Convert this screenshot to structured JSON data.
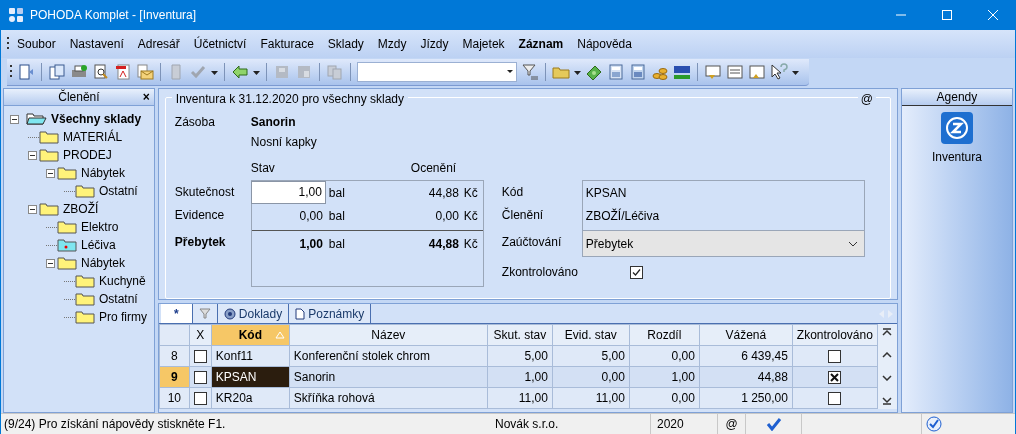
{
  "window": {
    "title": "POHODA Komplet - [Inventura]"
  },
  "menu": [
    {
      "label": "Soubor",
      "active": false
    },
    {
      "label": "Nastavení",
      "active": false
    },
    {
      "label": "Adresář",
      "active": false
    },
    {
      "label": "Účetnictví",
      "active": false
    },
    {
      "label": "Fakturace",
      "active": false
    },
    {
      "label": "Sklady",
      "active": false
    },
    {
      "label": "Mzdy",
      "active": false
    },
    {
      "label": "Jízdy",
      "active": false
    },
    {
      "label": "Majetek",
      "active": false
    },
    {
      "label": "Záznam",
      "active": true
    },
    {
      "label": "Nápověda",
      "active": false
    }
  ],
  "sidebar": {
    "title": "Členění",
    "close": "×",
    "tree": [
      {
        "label": "Všechny sklady",
        "kind": "root",
        "selected": true,
        "expanded": true,
        "children": [
          {
            "label": "MATERIÁL",
            "kind": "folder",
            "selected": false
          },
          {
            "label": "PRODEJ",
            "kind": "folder",
            "selected": false,
            "expanded": true,
            "children": [
              {
                "label": "Nábytek",
                "kind": "folder",
                "selected": false,
                "expanded": true,
                "children": [
                  {
                    "label": "Ostatní",
                    "kind": "folder",
                    "selected": false
                  }
                ]
              }
            ]
          },
          {
            "label": "ZBOŽÍ",
            "kind": "folder",
            "selected": false,
            "expanded": true,
            "children": [
              {
                "label": "Elektro",
                "kind": "folder",
                "selected": false
              },
              {
                "label": "Léčiva",
                "kind": "current",
                "selected": false
              },
              {
                "label": "Nábytek",
                "kind": "folder",
                "selected": false,
                "expanded": true,
                "children": [
                  {
                    "label": "Kuchyně",
                    "kind": "folder",
                    "selected": false
                  },
                  {
                    "label": "Ostatní",
                    "kind": "folder",
                    "selected": false
                  },
                  {
                    "label": "Pro firmy",
                    "kind": "folder",
                    "selected": false
                  }
                ]
              }
            ]
          }
        ]
      }
    ]
  },
  "form": {
    "title": "Inventura k 31.12.2020 pro všechny sklady",
    "at": "@",
    "stock_label": "Zásoba",
    "stock_name": "Sanorin",
    "stock_desc": "Nosní kapky",
    "col_state": "Stav",
    "col_value": "Ocenění",
    "rows": [
      {
        "kind": "input",
        "label": "Skutečnost",
        "qty": "1,00",
        "unit": "bal",
        "value": "44,88",
        "currency": "Kč"
      },
      {
        "kind": "plain",
        "label": "Evidence",
        "qty": "0,00",
        "unit": "bal",
        "value": "0,00",
        "currency": "Kč"
      },
      {
        "kind": "total",
        "label": "Přebytek",
        "qty": "1,00",
        "unit": "bal",
        "value": "44,88",
        "currency": "Kč"
      }
    ],
    "code_label": "Kód",
    "code": "KPSAN",
    "group_label": "Členění",
    "group": "ZBOŽÍ/Léčiva",
    "posting_label": "Zaúčtování",
    "posting": "Přebytek",
    "checked_label": "Zkontrolováno",
    "checked": true
  },
  "tabs": [
    {
      "kind": "star",
      "label": "*",
      "selected": true
    },
    {
      "kind": "filter",
      "selected": false
    },
    {
      "kind": "docs",
      "label": "Doklady",
      "selected": false
    },
    {
      "kind": "notes",
      "label": "Poznámky",
      "selected": false
    }
  ],
  "table": {
    "columns": [
      {
        "label": "X",
        "sorted": false
      },
      {
        "label": "Kód",
        "sorted": true
      },
      {
        "label": "Název",
        "sorted": false
      },
      {
        "label": "Skut. stav",
        "sorted": false
      },
      {
        "label": "Evid. stav",
        "sorted": false
      },
      {
        "label": "Rozdíl",
        "sorted": false
      },
      {
        "label": "Vážená",
        "sorted": false
      },
      {
        "label": "Zkontrolováno",
        "sorted": false
      }
    ],
    "rows": [
      {
        "number": "8",
        "marked": false,
        "cells": [
          "",
          "Konf11",
          "Konferenční stolek chrom",
          "5,00",
          "5,00",
          "0,00",
          "6 439,45"
        ],
        "checked": false,
        "selected": false
      },
      {
        "number": "9",
        "marked": false,
        "cells": [
          "",
          "KPSAN",
          "Sanorin",
          "1,00",
          "0,00",
          "1,00",
          "44,88"
        ],
        "checked": true,
        "selected": true
      },
      {
        "number": "10",
        "marked": false,
        "cells": [
          "",
          "KR20a",
          "Skříňka rohová",
          "11,00",
          "11,00",
          "0,00",
          "1 250,00"
        ],
        "checked": false,
        "selected": false
      }
    ]
  },
  "agendas": {
    "title": "Agendy",
    "items": [
      "Inventura"
    ]
  },
  "status_bar": {
    "help": "(9/24) Pro získání nápovědy stiskněte F1.",
    "company": "Novák s.r.o.",
    "year": "2020",
    "at": "@"
  }
}
